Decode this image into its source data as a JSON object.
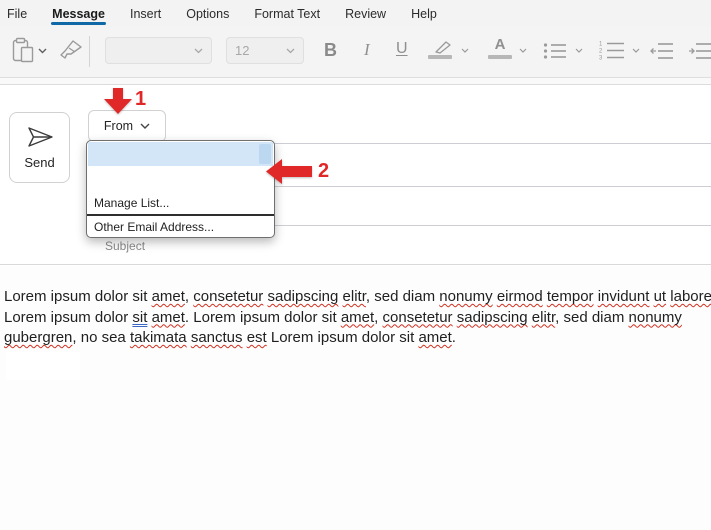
{
  "menu_bar": {
    "items": [
      {
        "label": "File",
        "active": false
      },
      {
        "label": "Message",
        "active": true
      },
      {
        "label": "Insert",
        "active": false
      },
      {
        "label": "Options",
        "active": false
      },
      {
        "label": "Format Text",
        "active": false
      },
      {
        "label": "Review",
        "active": false
      },
      {
        "label": "Help",
        "active": false
      }
    ],
    "active_underline_color": "#1168a7"
  },
  "toolbar": {
    "font_name_value": "",
    "font_size_value": "12",
    "bold_label": "B",
    "italic_label": "I",
    "underline_label": "U",
    "font_color_label": "A"
  },
  "compose": {
    "send_label": "Send",
    "from_label": "From",
    "subject_placeholder": "Subject"
  },
  "from_dropdown": {
    "selected_account": "",
    "highlight_color": "#d3e6f8",
    "items": [
      "Manage List...",
      "Other Email Address..."
    ]
  },
  "annotations": {
    "arrow_color": "#e02828",
    "step1_label": "1",
    "step2_label": "2"
  },
  "body": {
    "lines": [
      [
        {
          "t": "Lorem ipsum dolor sit ",
          "m": "none"
        },
        {
          "t": "amet",
          "m": "spell"
        },
        {
          "t": ", ",
          "m": "none"
        },
        {
          "t": "consetetur",
          "m": "spell"
        },
        {
          "t": " ",
          "m": "none"
        },
        {
          "t": "sadipscing",
          "m": "spell"
        },
        {
          "t": " ",
          "m": "none"
        },
        {
          "t": "elitr",
          "m": "spell"
        },
        {
          "t": ", sed diam ",
          "m": "none"
        },
        {
          "t": "nonumy",
          "m": "spell"
        },
        {
          "t": " ",
          "m": "none"
        },
        {
          "t": "eirmod",
          "m": "spell"
        },
        {
          "t": " ",
          "m": "none"
        },
        {
          "t": "tempor",
          "m": "spell"
        },
        {
          "t": " ",
          "m": "none"
        },
        {
          "t": "invidunt",
          "m": "spell"
        },
        {
          "t": " ",
          "m": "none"
        },
        {
          "t": "ut",
          "m": "spell"
        },
        {
          "t": " ",
          "m": "none"
        },
        {
          "t": "labore",
          "m": "spell"
        }
      ],
      [
        {
          "t": "Lorem ipsum dolor ",
          "m": "none"
        },
        {
          "t": "sit",
          "m": "grammar"
        },
        {
          "t": " ",
          "m": "none"
        },
        {
          "t": "amet",
          "m": "spell"
        },
        {
          "t": ". Lorem ipsum dolor sit ",
          "m": "none"
        },
        {
          "t": "amet",
          "m": "spell"
        },
        {
          "t": ", ",
          "m": "none"
        },
        {
          "t": "consetetur",
          "m": "spell"
        },
        {
          "t": " ",
          "m": "none"
        },
        {
          "t": "sadipscing",
          "m": "spell"
        },
        {
          "t": " ",
          "m": "none"
        },
        {
          "t": "elitr",
          "m": "spell"
        },
        {
          "t": ", sed diam ",
          "m": "none"
        },
        {
          "t": "nonumy",
          "m": "spell"
        }
      ],
      [
        {
          "t": "gubergren",
          "m": "spell"
        },
        {
          "t": ", no sea ",
          "m": "none"
        },
        {
          "t": "takimata",
          "m": "spell"
        },
        {
          "t": " ",
          "m": "none"
        },
        {
          "t": "sanctus",
          "m": "spell"
        },
        {
          "t": " ",
          "m": "none"
        },
        {
          "t": "est",
          "m": "spell"
        },
        {
          "t": " Lorem ipsum dolor sit ",
          "m": "none"
        },
        {
          "t": "amet",
          "m": "spell"
        },
        {
          "t": ".",
          "m": "none"
        }
      ]
    ]
  }
}
